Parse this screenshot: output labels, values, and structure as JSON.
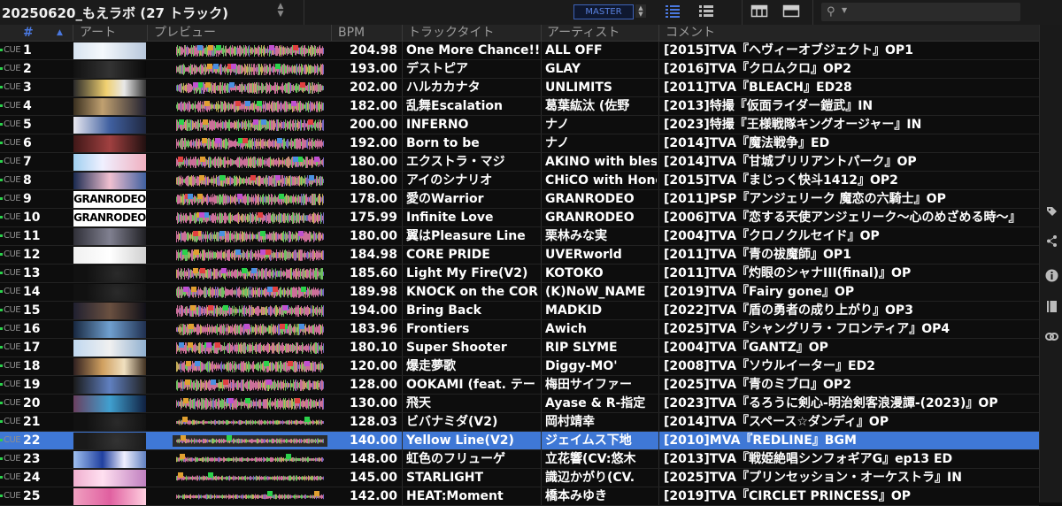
{
  "header": {
    "playlist_title": "20250620_もえラボ (27 トラック)",
    "master_label": "MASTER"
  },
  "columns": {
    "num": "#",
    "artwork": "アート",
    "preview": "プレビュー",
    "bpm": "BPM",
    "title": "トラックタイト",
    "artist": "アーティスト",
    "comment": "コメント"
  },
  "cue_label": "CUE",
  "icons": {
    "sort_arrows": "updown-arrows-icon",
    "list_view": "list-view-icon",
    "detail_view": "detail-list-icon",
    "browser_layout": "browser-layout-icon",
    "panel_layout": "panel-layout-icon",
    "search": "search-icon",
    "tag": "tag-icon",
    "related": "share-nodes-icon",
    "info": "info-icon",
    "memo": "notebook-icon",
    "link": "link-icon"
  },
  "colors": {
    "accent": "#3f78d6",
    "cue_dot": "#2bd24b",
    "waveform_pink": "#e07aa8",
    "waveform_green": "#7ad36a"
  },
  "tracks": [
    {
      "n": "1",
      "bpm": "204.98",
      "title": "One More Chance!!",
      "artist": "ALL OFF",
      "comment": "[2015]TVA『ヘヴィーオブジェクト』OP1"
    },
    {
      "n": "2",
      "bpm": "193.00",
      "title": "デストピア",
      "artist": "GLAY",
      "comment": "[2016]TVA『クロムクロ』OP2"
    },
    {
      "n": "3",
      "bpm": "202.00",
      "title": "ハルカカナタ",
      "artist": "UNLIMITS",
      "comment": "[2011]TVA『BLEACH』ED28"
    },
    {
      "n": "4",
      "bpm": "182.00",
      "title": "乱舞Escalation",
      "artist": "葛葉紘汰 (佐野",
      "comment": "[2013]特撮『仮面ライダー鎧武』IN"
    },
    {
      "n": "5",
      "bpm": "200.00",
      "title": "INFERNO",
      "artist": "ナノ",
      "comment": "[2023]特撮『王様戦隊キングオージャー』IN"
    },
    {
      "n": "6",
      "bpm": "192.00",
      "title": "Born to be",
      "artist": "ナノ",
      "comment": "[2014]TVA『魔法戦争』ED"
    },
    {
      "n": "7",
      "bpm": "180.00",
      "title": "エクストラ・マジ",
      "artist": "AKINO with bles",
      "comment": "[2014]TVA『甘城ブリリアントパーク』OP"
    },
    {
      "n": "8",
      "bpm": "180.00",
      "title": "アイのシナリオ",
      "artist": "CHiCO with Hone",
      "comment": "[2015]TVA『まじっく快斗1412』OP2"
    },
    {
      "n": "9",
      "bpm": "178.00",
      "title": "愛のWarrior",
      "artist": "GRANRODEO",
      "comment": "[2011]PSP『アンジェリーク 魔恋の六騎士』OP"
    },
    {
      "n": "10",
      "bpm": "175.99",
      "title": "Infinite Love",
      "artist": "GRANRODEO",
      "comment": "[2006]TVA『恋する天使アンジェリーク〜心のめざめる時〜』"
    },
    {
      "n": "11",
      "bpm": "180.00",
      "title": "翼はPleasure Line",
      "artist": "栗林みな実",
      "comment": "[2004]TVA『クロノクルセイド』OP"
    },
    {
      "n": "12",
      "bpm": "184.98",
      "title": "CORE PRIDE",
      "artist": "UVERworld",
      "comment": "[2011]TVA『青の祓魔師』OP1"
    },
    {
      "n": "13",
      "bpm": "185.60",
      "title": "Light My Fire(V2)",
      "artist": "KOTOKO",
      "comment": "[2011]TVA『灼眼のシャナIII(final)』OP"
    },
    {
      "n": "14",
      "bpm": "189.98",
      "title": "KNOCK on the COR",
      "artist": "(K)NoW_NAME",
      "comment": "[2019]TVA『Fairy gone』OP"
    },
    {
      "n": "15",
      "bpm": "194.00",
      "title": "Bring Back",
      "artist": "MADKID",
      "comment": "[2022]TVA『盾の勇者の成り上がり』OP3"
    },
    {
      "n": "16",
      "bpm": "183.96",
      "title": "Frontiers",
      "artist": "Awich",
      "comment": "[2025]TVA『シャングリラ・フロンティア』OP4"
    },
    {
      "n": "17",
      "bpm": "180.10",
      "title": "Super Shooter",
      "artist": "RIP SLYME",
      "comment": "[2004]TVA『GANTZ』OP"
    },
    {
      "n": "18",
      "bpm": "120.00",
      "title": "爆走夢歌",
      "artist": "Diggy-MO'",
      "comment": "[2008]TVA『ソウルイーター』ED2"
    },
    {
      "n": "19",
      "bpm": "128.00",
      "title": "OOKAMI (feat. テー",
      "artist": "梅田サイファー",
      "comment": "[2025]TVA『青のミブロ』OP2"
    },
    {
      "n": "20",
      "bpm": "130.00",
      "title": "飛天",
      "artist": "Ayase & R-指定",
      "comment": "[2023]TVA『るろうに剣心-明治剣客浪漫譚-(2023)』OP"
    },
    {
      "n": "21",
      "bpm": "128.03",
      "title": "ビバナミダ(V2)",
      "artist": "岡村靖幸",
      "comment": "[2014]TVA『スペース☆ダンディ』OP"
    },
    {
      "n": "22",
      "bpm": "140.00",
      "title": "Yellow Line(V2)",
      "artist": "ジェイムス下地",
      "comment": "[2010]MVA『REDLINE』BGM"
    },
    {
      "n": "23",
      "bpm": "148.00",
      "title": "虹色のフリューゲ",
      "artist": "立花響(CV:悠木",
      "comment": "[2013]TVA『戦姫絶唱シンフォギアG』ep13 ED"
    },
    {
      "n": "24",
      "bpm": "145.00",
      "title": "STARLIGHT",
      "artist": "識辺かがり(CV.",
      "comment": "[2025]TVA『プリンセッション・オーケストラ』IN"
    },
    {
      "n": "25",
      "bpm": "142.00",
      "title": "HEAT:Moment",
      "artist": "橋本みゆき",
      "comment": "[2019]TVA『CIRCLET PRINCESS』OP"
    }
  ],
  "artwork_logo_text": "GRANRODEO",
  "selected_row": 22
}
